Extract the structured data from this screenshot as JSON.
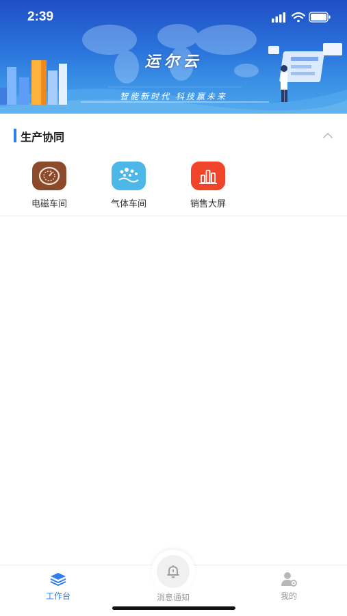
{
  "status_bar": {
    "time": "2:39"
  },
  "banner": {
    "title": "运尔云",
    "slogan": "智能新时代    科技赢未来"
  },
  "section": {
    "title": "生产协同",
    "collapse_icon": "chevron-up-icon"
  },
  "apps": [
    {
      "label": "电磁车间",
      "icon": "gauge-icon",
      "color": "#8b4a2b"
    },
    {
      "label": "气体车间",
      "icon": "bubbles-icon",
      "color": "#4db8e8"
    },
    {
      "label": "销售大屏",
      "icon": "bar-chart-icon",
      "color": "#f0452a"
    }
  ],
  "tabs": [
    {
      "label": "工作台",
      "icon": "stack-icon",
      "active": true
    },
    {
      "label": "消息通知",
      "icon": "bell-icon",
      "active": false
    },
    {
      "label": "我的",
      "icon": "user-settings-icon",
      "active": false
    }
  ],
  "colors": {
    "accent": "#2d7cf0",
    "banner": "#2a74dc"
  }
}
